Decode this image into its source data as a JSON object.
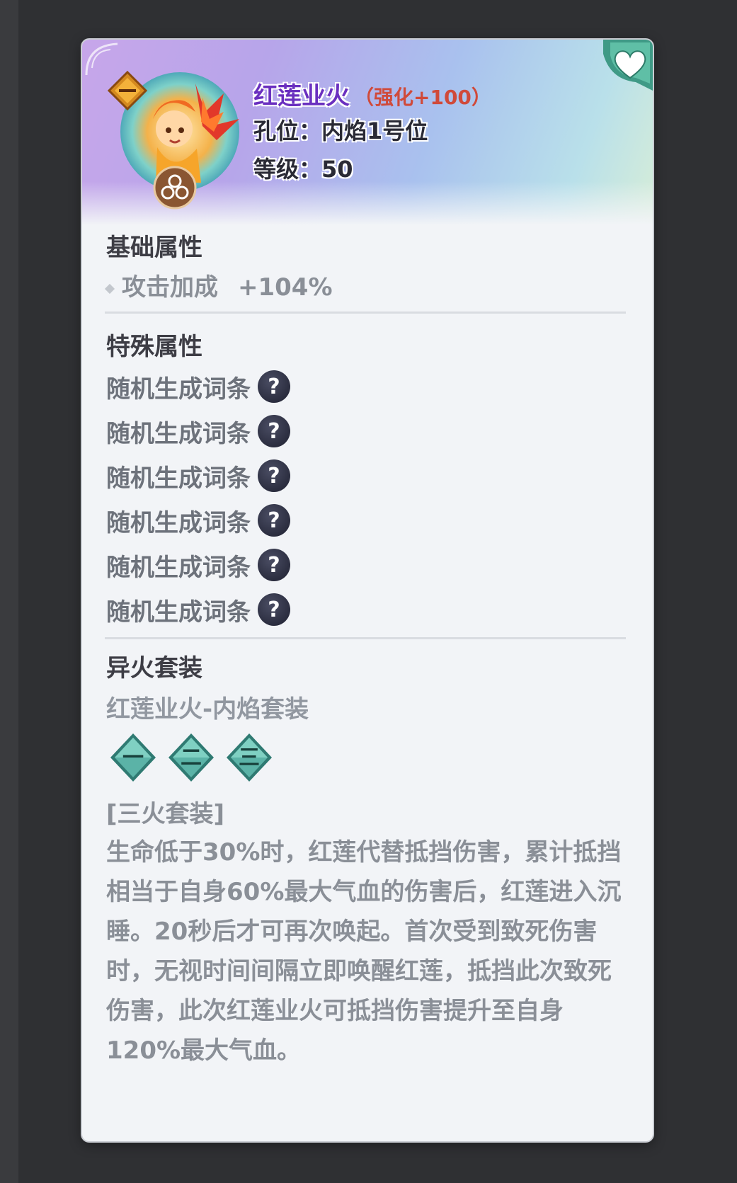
{
  "item": {
    "name": "红莲业火",
    "enhance": "（强化+100）",
    "slot": "孔位：内焰1号位",
    "level": "等级：50",
    "rank_glyph": "一",
    "favorite_icon": "heart-icon"
  },
  "basic": {
    "title": "基础属性",
    "stat_name": "攻击加成",
    "stat_value": "+104%"
  },
  "special": {
    "title": "特殊属性",
    "items": [
      "随机生成词条",
      "随机生成词条",
      "随机生成词条",
      "随机生成词条",
      "随机生成词条",
      "随机生成词条"
    ],
    "help_glyph": "?"
  },
  "set": {
    "title": "异火套装",
    "name": "红莲业火-内焰套装",
    "gems": [
      "一",
      "二",
      "三"
    ],
    "bonus_title": "[三火套装]",
    "description": "生命低于30%时，红莲代替抵挡伤害，累计抵挡相当于自身60%最大气血的伤害后，红莲进入沉睡。20秒后才可再次唤起。首次受到致死伤害时，无视时间间隔立即唤醒红莲，抵挡此次致死伤害，此次红莲业火可抵挡伤害提升至自身120%最大气血。"
  },
  "colors": {
    "name": "#6a2fbf",
    "enhance": "#d04a3a",
    "gem": "#3e8f86",
    "muted_text": "#8a8f97"
  }
}
